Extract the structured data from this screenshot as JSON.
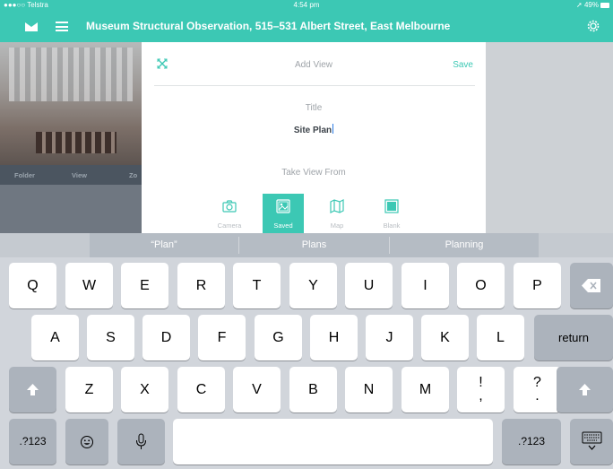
{
  "status": {
    "carrier": "●●●○○ Telstra",
    "time": "4:54 pm",
    "battery": "49%"
  },
  "nav": {
    "title": "Museum Structural Observation, 515–531 Albert Street, East Melbourne"
  },
  "background": {
    "tabs": [
      "Folder",
      "View",
      "Zo"
    ]
  },
  "modal": {
    "title": "Add View",
    "save_label": "Save",
    "field_label": "Title",
    "field_value": "Site Plan",
    "take_from_label": "Take View From",
    "options": [
      {
        "label": "Camera",
        "icon": "camera-icon",
        "selected": false
      },
      {
        "label": "Saved",
        "icon": "saved-image-icon",
        "selected": true
      },
      {
        "label": "Map",
        "icon": "map-icon",
        "selected": false
      },
      {
        "label": "Blank",
        "icon": "blank-icon",
        "selected": false
      }
    ]
  },
  "predictive": {
    "suggestions": [
      "“Plan”",
      "Plans",
      "Planning"
    ]
  },
  "keyboard": {
    "row1": [
      "Q",
      "W",
      "E",
      "R",
      "T",
      "Y",
      "U",
      "I",
      "O",
      "P"
    ],
    "row2": [
      "A",
      "S",
      "D",
      "F",
      "G",
      "H",
      "J",
      "K",
      "L"
    ],
    "row3": [
      "Z",
      "X",
      "C",
      "V",
      "B",
      "N",
      "M"
    ],
    "exclaim": "!\n,",
    "question": "?\n.",
    "return_label": "return",
    "numbers_label": ".?123"
  },
  "colors": {
    "accent": "#3cc8b4"
  }
}
